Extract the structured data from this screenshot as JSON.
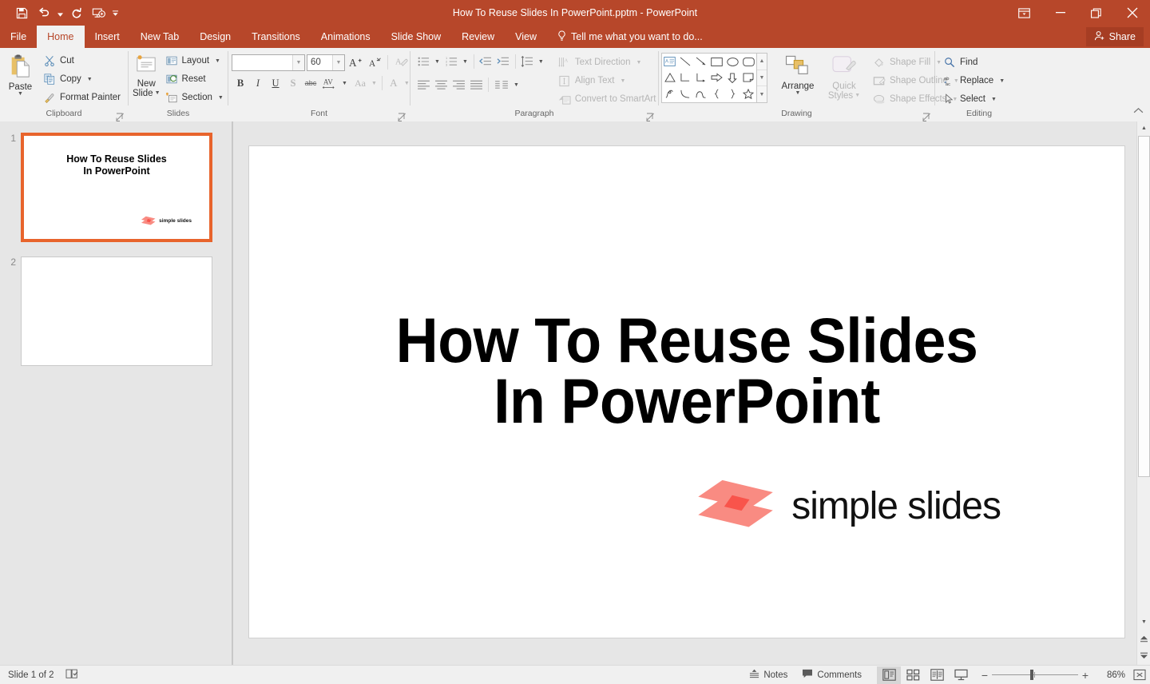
{
  "app": {
    "title": "How To Reuse Slides In PowerPoint.pptm - PowerPoint",
    "accent_color": "#B7472A",
    "ribbon_bg": "#F1F1F1",
    "selection_color": "#E8642C"
  },
  "quick_access": {
    "items": [
      {
        "name": "save-icon",
        "label": "Save"
      },
      {
        "name": "undo-icon",
        "label": "Undo"
      },
      {
        "name": "redo-icon",
        "label": "Redo"
      },
      {
        "name": "start-presentation-icon",
        "label": "Start From Beginning"
      },
      {
        "name": "customize-qat-icon",
        "label": "Customize Quick Access Toolbar"
      }
    ]
  },
  "window_controls": {
    "ribbon_display_options": "Ribbon Display Options",
    "minimize": "Minimize",
    "restore": "Restore Down",
    "close": "Close"
  },
  "tabs": [
    {
      "label": "File",
      "active": false
    },
    {
      "label": "Home",
      "active": true
    },
    {
      "label": "Insert",
      "active": false
    },
    {
      "label": "New Tab",
      "active": false
    },
    {
      "label": "Design",
      "active": false
    },
    {
      "label": "Transitions",
      "active": false
    },
    {
      "label": "Animations",
      "active": false
    },
    {
      "label": "Slide Show",
      "active": false
    },
    {
      "label": "Review",
      "active": false
    },
    {
      "label": "View",
      "active": false
    }
  ],
  "tell_me": {
    "placeholder": "Tell me what you want to do..."
  },
  "share": {
    "label": "Share"
  },
  "ribbon": {
    "clipboard": {
      "group_label": "Clipboard",
      "paste_label": "Paste",
      "cut_label": "Cut",
      "copy_label": "Copy",
      "format_painter_label": "Format Painter"
    },
    "slides": {
      "group_label": "Slides",
      "new_slide_line1": "New",
      "new_slide_line2": "Slide",
      "layout_label": "Layout",
      "reset_label": "Reset",
      "section_label": "Section"
    },
    "font": {
      "group_label": "Font",
      "font_name_value": "",
      "font_name_placeholder": "",
      "font_size_value": "60",
      "bold": "B",
      "italic": "I",
      "underline": "U",
      "shadow": "S",
      "strikethrough": "abc",
      "character_spacing": "AV",
      "change_case": "Aa",
      "font_color": "A",
      "increase_font": "A",
      "decrease_font": "A",
      "clear_formatting": "Clear All Formatting"
    },
    "paragraph": {
      "group_label": "Paragraph",
      "text_direction_label": "Text Direction",
      "align_text_label": "Align Text",
      "convert_smartart_label": "Convert to SmartArt"
    },
    "drawing": {
      "group_label": "Drawing",
      "arrange_label": "Arrange",
      "quick_styles_line1": "Quick",
      "quick_styles_line2": "Styles",
      "shape_fill_label": "Shape Fill",
      "shape_outline_label": "Shape Outline",
      "shape_effects_label": "Shape Effects"
    },
    "editing": {
      "group_label": "Editing",
      "find_label": "Find",
      "replace_label": "Replace",
      "select_label": "Select"
    }
  },
  "slides_panel": {
    "slides": [
      {
        "number": "1",
        "selected": true,
        "title": "How To Reuse Slides\nIn PowerPoint",
        "logo_text": "simple slides"
      },
      {
        "number": "2",
        "selected": false,
        "title": "",
        "logo_text": ""
      }
    ]
  },
  "slide_canvas": {
    "title_line1": "How To Reuse Slides",
    "title_line2": "In PowerPoint",
    "logo_text": "simple slides",
    "logo_color": "#F98B82",
    "logo_overlap_color": "#F9544B"
  },
  "status_bar": {
    "slide_counter": "Slide 1 of 2",
    "accessibility_icon": "accessibility-checker",
    "notes_label": "Notes",
    "comments_label": "Comments",
    "views": [
      {
        "name": "normal-view",
        "active": true
      },
      {
        "name": "slide-sorter-view",
        "active": false
      },
      {
        "name": "reading-view",
        "active": false
      },
      {
        "name": "slide-show-view",
        "active": false
      }
    ],
    "zoom_out": "−",
    "zoom_in": "+",
    "zoom_level": "86%",
    "fit_to_window": "Fit slide to current window"
  }
}
